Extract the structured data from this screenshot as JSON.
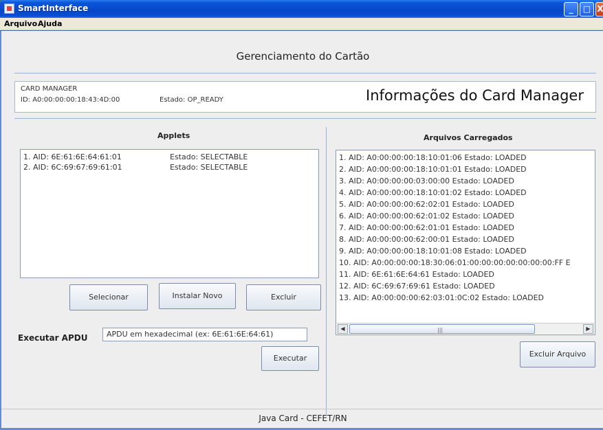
{
  "window": {
    "title": "SmartInterface",
    "icon": "java-app-icon",
    "controls": {
      "minimize": "_",
      "maximize": "□",
      "close": "X"
    }
  },
  "menubar": [
    "Arquivo",
    "Ajuda"
  ],
  "page_title": "Gerenciamento do Cartão",
  "card_manager": {
    "name": "CARD MANAGER",
    "id": "ID: A0:00:00:00:18:43:4D:00",
    "state": "Estado: OP_READY",
    "heading": "Informações do Card Manager"
  },
  "applets": {
    "label": "Applets",
    "items": [
      {
        "aid": "1. AID: 6E:61:6E:64:61:01",
        "state": "Estado: SELECTABLE"
      },
      {
        "aid": "2. AID: 6C:69:67:69:61:01",
        "state": "Estado: SELECTABLE"
      }
    ],
    "buttons": {
      "select": "Selecionar",
      "install": "Instalar Novo",
      "delete": "Excluir"
    }
  },
  "apdu": {
    "label": "Executar APDU",
    "placeholder": "APDU em hexadecimal (ex: 6E:61:6E:64:61)",
    "execute_button": "Executar"
  },
  "loaded_files": {
    "label": "Arquivos Carregados",
    "items": [
      "1. AID: A0:00:00:00:18:10:01:06   Estado: LOADED",
      "2. AID: A0:00:00:00:18:10:01:01   Estado: LOADED",
      "3. AID: A0:00:00:00:03:00:00   Estado: LOADED",
      "4. AID: A0:00:00:00:18:10:01:02   Estado: LOADED",
      "5. AID: A0:00:00:00:62:02:01   Estado: LOADED",
      "6. AID: A0:00:00:00:62:01:02   Estado: LOADED",
      "7. AID: A0:00:00:00:62:01:01   Estado: LOADED",
      "8. AID: A0:00:00:00:62:00:01   Estado: LOADED",
      "9. AID: A0:00:00:00:18:10:01:08   Estado: LOADED",
      "10. AID: A0:00:00:00:18:30:06:01:00:00:00:00:00:00:00:FF   E",
      "11. AID: 6E:61:6E:64:61   Estado: LOADED",
      "12. AID: 6C:69:67:69:61   Estado: LOADED",
      "13. AID: A0:00:00:00:62:03:01:0C:02   Estado: LOADED"
    ],
    "delete_button": "Excluir Arquivo",
    "scrollbar": {
      "left": "◀",
      "right": "▶",
      "grip": "|||"
    }
  },
  "footer": "Java Card - CEFET/RN",
  "colors": {
    "titlebar": "#0846c8",
    "panel": "#eeeeee",
    "border": "#9ab0d0"
  }
}
